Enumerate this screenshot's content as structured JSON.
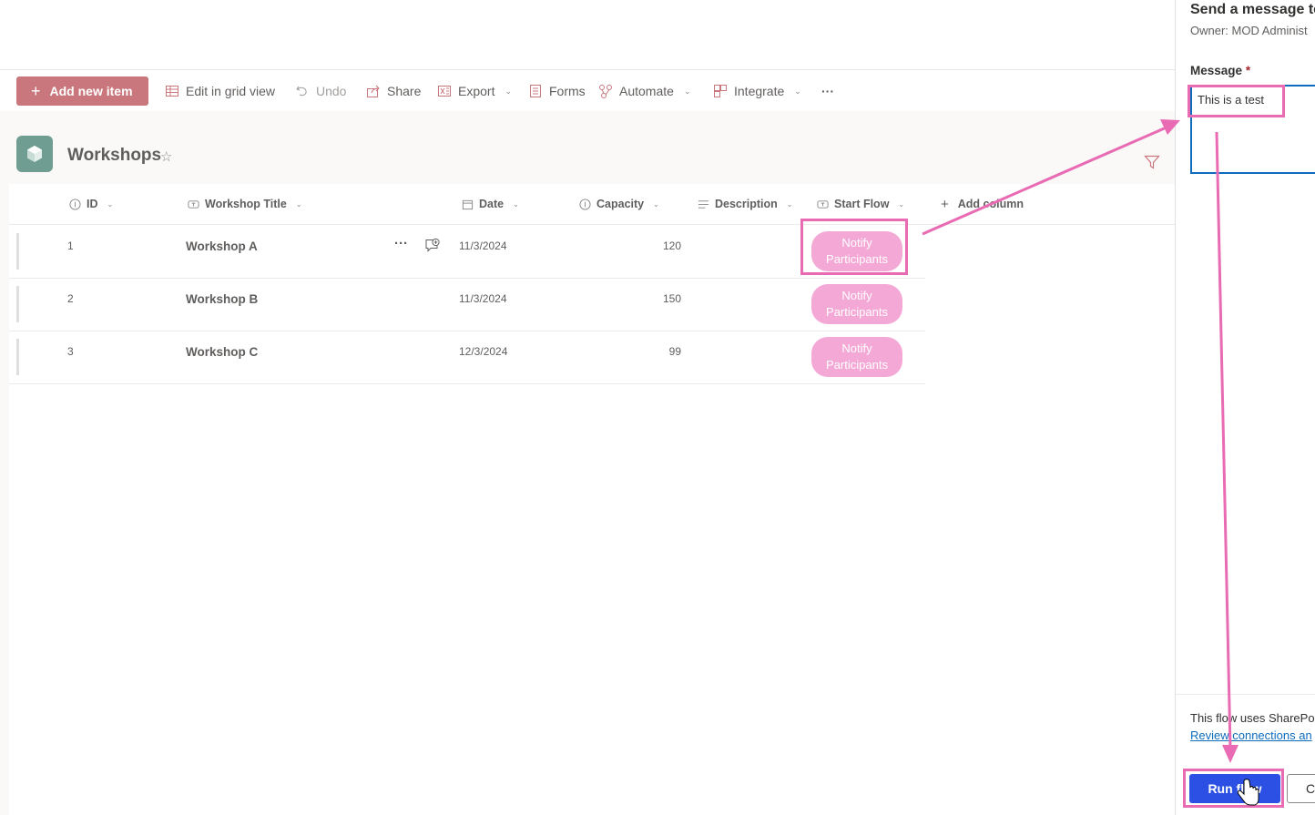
{
  "commandbar": {
    "add_new_item": "Add new item",
    "edit_grid": "Edit in grid view",
    "undo": "Undo",
    "share": "Share",
    "export": "Export",
    "forms": "Forms",
    "automate": "Automate",
    "integrate": "Integrate",
    "more": "···"
  },
  "list": {
    "title": "Workshops",
    "star": "☆"
  },
  "columns": {
    "id": "ID",
    "title": "Workshop Title",
    "date": "Date",
    "capacity": "Capacity",
    "description": "Description",
    "start_flow": "Start Flow",
    "add_column": "Add column"
  },
  "rows": [
    {
      "id": "1",
      "title": "Workshop A",
      "date": "11/3/2024",
      "capacity": "120",
      "button_line1": "Notify",
      "button_line2": "Participants"
    },
    {
      "id": "2",
      "title": "Workshop B",
      "date": "11/3/2024",
      "capacity": "150",
      "button_line1": "Notify",
      "button_line2": "Participants"
    },
    {
      "id": "3",
      "title": "Workshop C",
      "date": "12/3/2024",
      "capacity": "99",
      "button_line1": "Notify",
      "button_line2": "Participants"
    }
  ],
  "row_more": "···",
  "panel": {
    "title": "Send a message to",
    "owner": "Owner: MOD Administ",
    "message_label": "Message",
    "required_mark": "*",
    "message_value": "This is a test",
    "uses_text": "This flow uses SharePo",
    "review_link": "Review connections an",
    "run_button": "Run flow",
    "cancel_button": "Ca"
  },
  "colors": {
    "accent_add": "#c9777d",
    "flow_button": "#f4a8d6",
    "run_button": "#2b50e3",
    "annotation": "#e86bb3"
  }
}
